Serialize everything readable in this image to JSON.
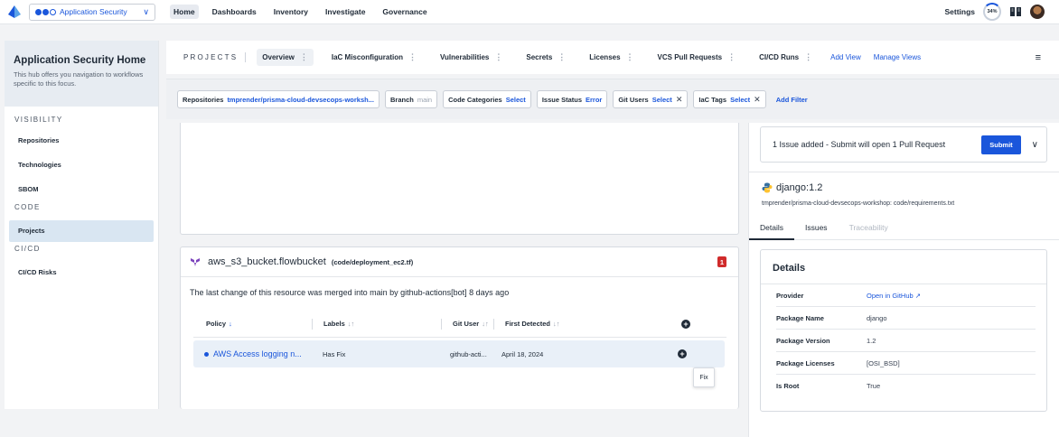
{
  "topbar": {
    "app_switcher": "Application Security",
    "nav": [
      "Home",
      "Dashboards",
      "Inventory",
      "Investigate",
      "Governance"
    ],
    "settings": "Settings",
    "progress": "34%"
  },
  "sidebar": {
    "title": "Application Security Home",
    "description": "This hub offers you navigation to workflows specific to this focus.",
    "sections": {
      "visibility": "VISIBILITY",
      "code": "CODE",
      "cicd": "CI/CD"
    },
    "items": {
      "repositories": "Repositories",
      "technologies": "Technologies",
      "sbom": "SBOM",
      "projects": "Projects",
      "cicd_risks": "CI/CD Risks"
    }
  },
  "tabbar": {
    "label": "PROJECTS",
    "tabs": [
      "Overview",
      "IaC Misconfiguration",
      "Vulnerabilities",
      "Secrets",
      "Licenses",
      "VCS Pull Requests",
      "CI/CD Runs"
    ],
    "add_view": "Add View",
    "manage_views": "Manage Views"
  },
  "filters": {
    "repositories": {
      "label": "Repositories",
      "value": "tmprender/prisma-cloud-devsecops-worksh..."
    },
    "branch": {
      "label": "Branch",
      "value": "main"
    },
    "code_categories": {
      "label": "Code Categories",
      "value": "Select"
    },
    "issue_status": {
      "label": "Issue Status",
      "value": "Error"
    },
    "git_users": {
      "label": "Git Users",
      "value": "Select"
    },
    "iac_tags": {
      "label": "IaC Tags",
      "value": "Select"
    },
    "add_filter": "Add Filter"
  },
  "resource": {
    "name": "aws_s3_bucket.flowbucket",
    "path": "(code/deployment_ec2.tf)",
    "count": "1",
    "description": "The last change of this resource was merged into main by github-actions[bot] 8 days ago",
    "columns": {
      "policy": "Policy",
      "labels": "Labels",
      "git_user": "Git User",
      "first_detected": "First Detected"
    },
    "rows": [
      {
        "policy": "AWS Access logging n...",
        "labels": "Has Fix",
        "git_user": "github-acti...",
        "first_detected": "April 18, 2024"
      }
    ],
    "tooltip": "Fix"
  },
  "right_panel": {
    "submit_text": "1 Issue added - Submit will open 1 Pull Request",
    "submit_button": "Submit",
    "package_title": "django:1.2",
    "package_path": "tmprender/prisma-cloud-devsecops-workshop: code/requirements.txt",
    "tabs": [
      "Details",
      "Issues",
      "Traceability"
    ],
    "details_title": "Details",
    "details": [
      {
        "key": "Provider",
        "value": "Open in GitHub"
      },
      {
        "key": "Package Name",
        "value": "django"
      },
      {
        "key": "Package Version",
        "value": "1.2"
      },
      {
        "key": "Package Licenses",
        "value": "[OSI_BSD]"
      },
      {
        "key": "Is Root",
        "value": "True"
      }
    ]
  },
  "colors": {
    "accent": "#1a56db",
    "danger": "#d02b2b"
  }
}
